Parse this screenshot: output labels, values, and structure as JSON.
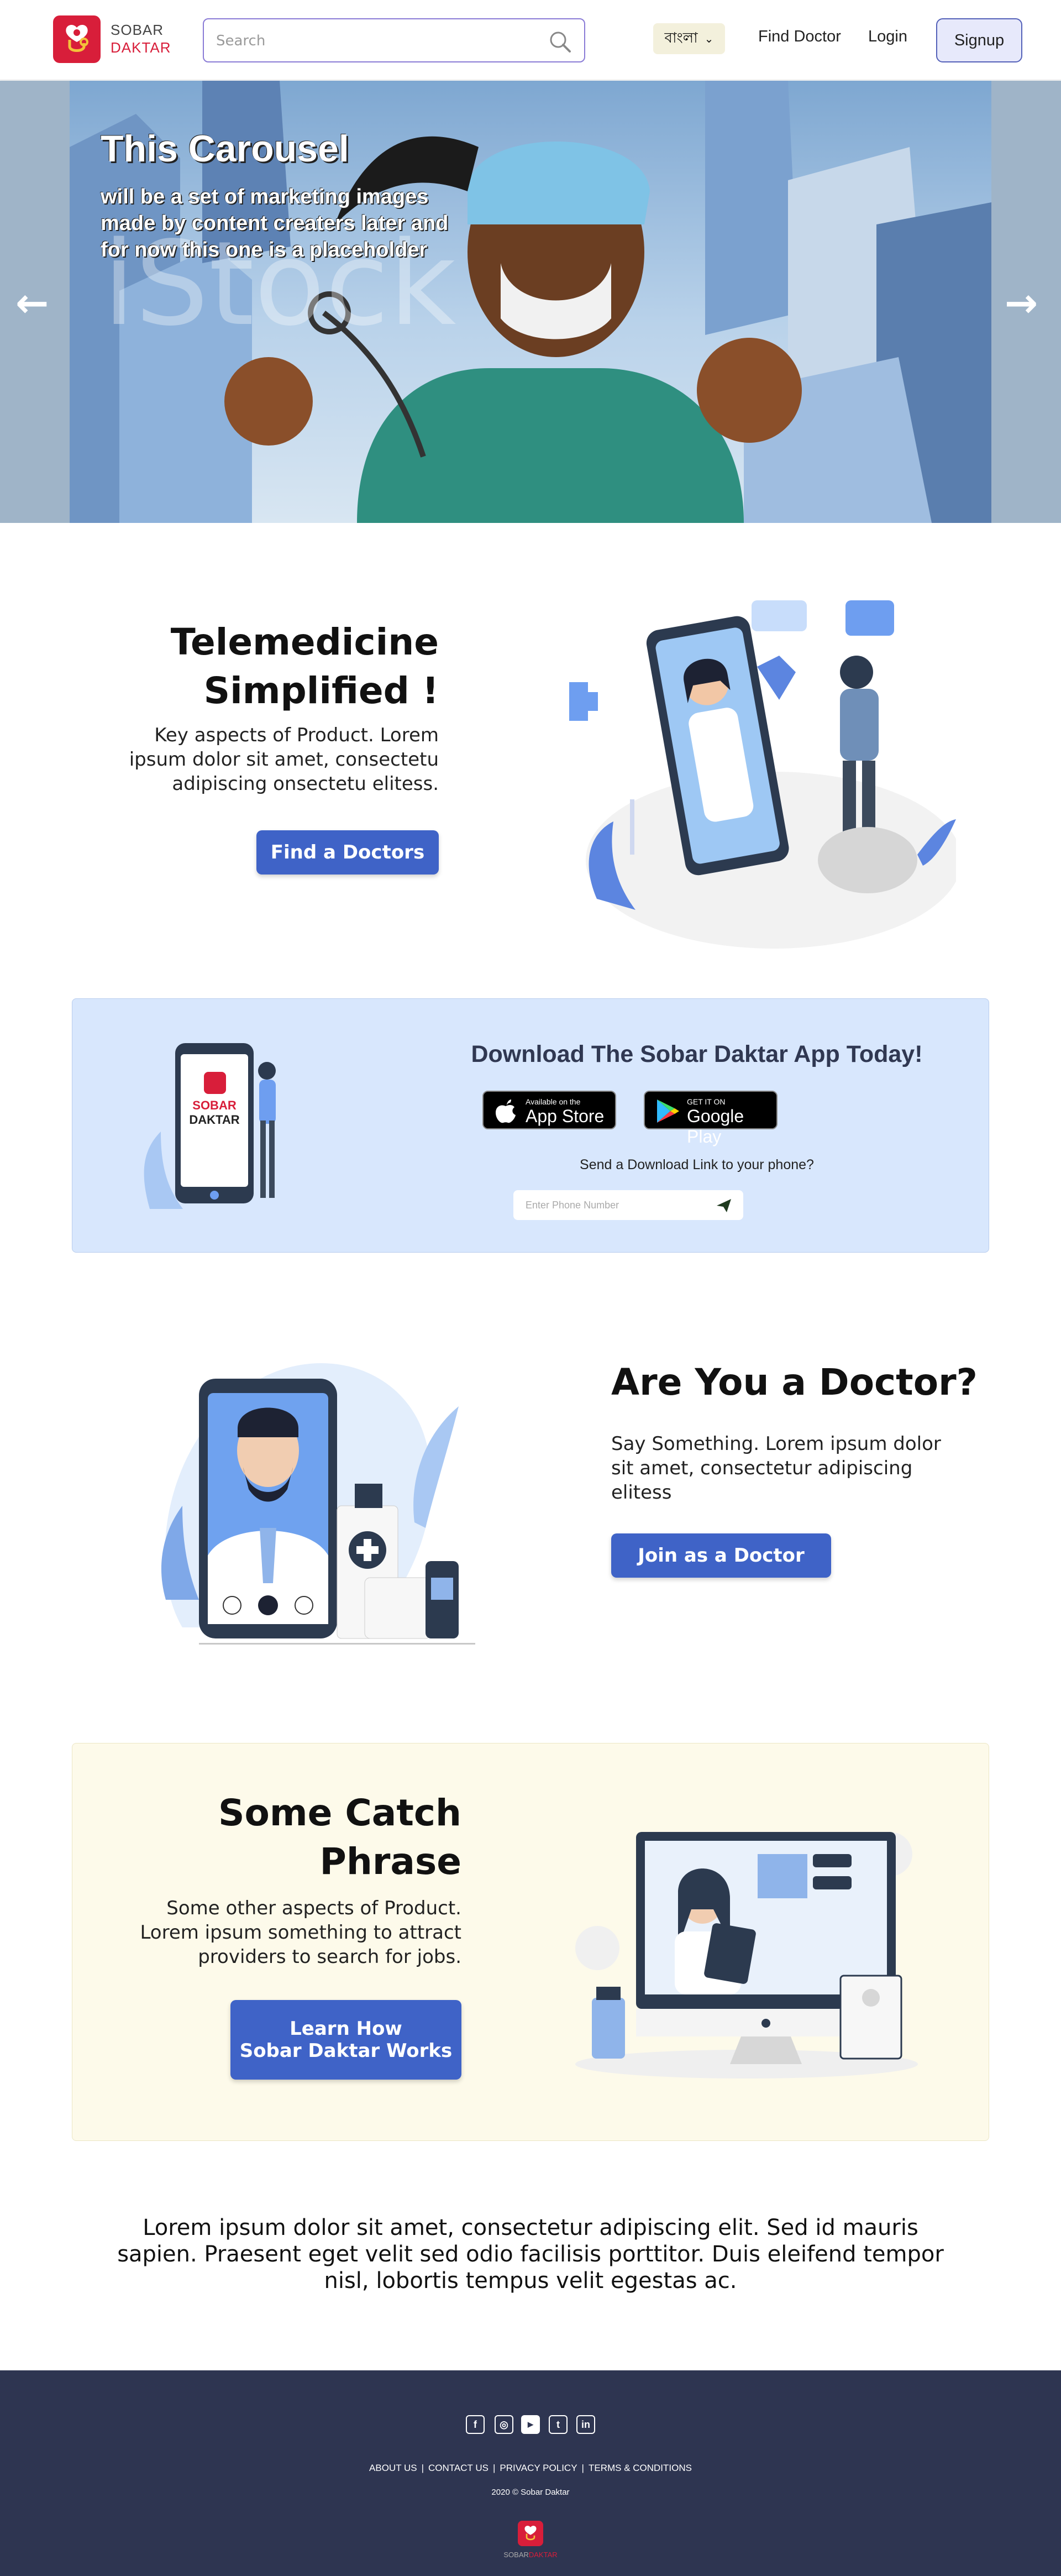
{
  "header": {
    "logo_line1": "SOBAR",
    "logo_line2": "DAKTAR",
    "search_placeholder": "Search",
    "language": "বাংলা",
    "find_doctor": "Find Doctor",
    "login": "Login",
    "signup": "Signup"
  },
  "carousel": {
    "title": "This Carousel",
    "subtitle": "will be a set of marketing images made by content creaters later and for now this one is a placeholder"
  },
  "telemedicine": {
    "title_line1": "Telemedicine",
    "title_line2": "Simplified !",
    "text": "Key aspects of Product. Lorem ipsum dolor sit amet, consectetu adipiscing onsectetu elitess.",
    "button": "Find a Doctors"
  },
  "download": {
    "phone_logo_line1": "SOBAR",
    "phone_logo_line2": "DAKTAR",
    "title": "Download The Sobar Daktar App Today!",
    "appstore_small": "Available on the",
    "appstore_big": "App Store",
    "googleplay_small": "GET IT ON",
    "googleplay_big": "Google Play",
    "send_text": "Send a Download Link to your phone?",
    "phone_placeholder": "Enter Phone Number"
  },
  "doctor": {
    "title": "Are You a Doctor?",
    "text": "Say Something. Lorem ipsum dolor sit amet, consectetur adipiscing elitess",
    "button": "Join as a Doctor"
  },
  "catch": {
    "title_line1": "Some Catch",
    "title_line2": "Phrase",
    "text": "Some other aspects of Product. Lorem ipsum something to attract providers to search for jobs.",
    "button_line1": "Learn How",
    "button_line2": "Sobar Daktar Works"
  },
  "lorem": "Lorem ipsum dolor sit amet, consectetur adipiscing elit. Sed id mauris sapien. Praesent eget velit sed odio facilisis porttitor. Duis eleifend tempor nisl, lobortis tempus velit egestas ac.",
  "footer": {
    "links": [
      "ABOUT US",
      "CONTACT US",
      "PRIVACY POLICY",
      "TERMS & CONDITIONS"
    ],
    "copyright": "2020 © Sobar Daktar",
    "logo_line1": "SOBAR",
    "logo_line2": "DAKTAR",
    "social_icons": [
      "facebook-icon",
      "instagram-icon",
      "youtube-icon",
      "twitter-icon",
      "linkedin-icon"
    ]
  },
  "colors": {
    "brand_red": "#d81e3a",
    "button_blue": "#3f63c7",
    "download_bg": "#d8e7fd",
    "catch_bg": "#fdfaea",
    "footer_bg": "#2e3551"
  }
}
